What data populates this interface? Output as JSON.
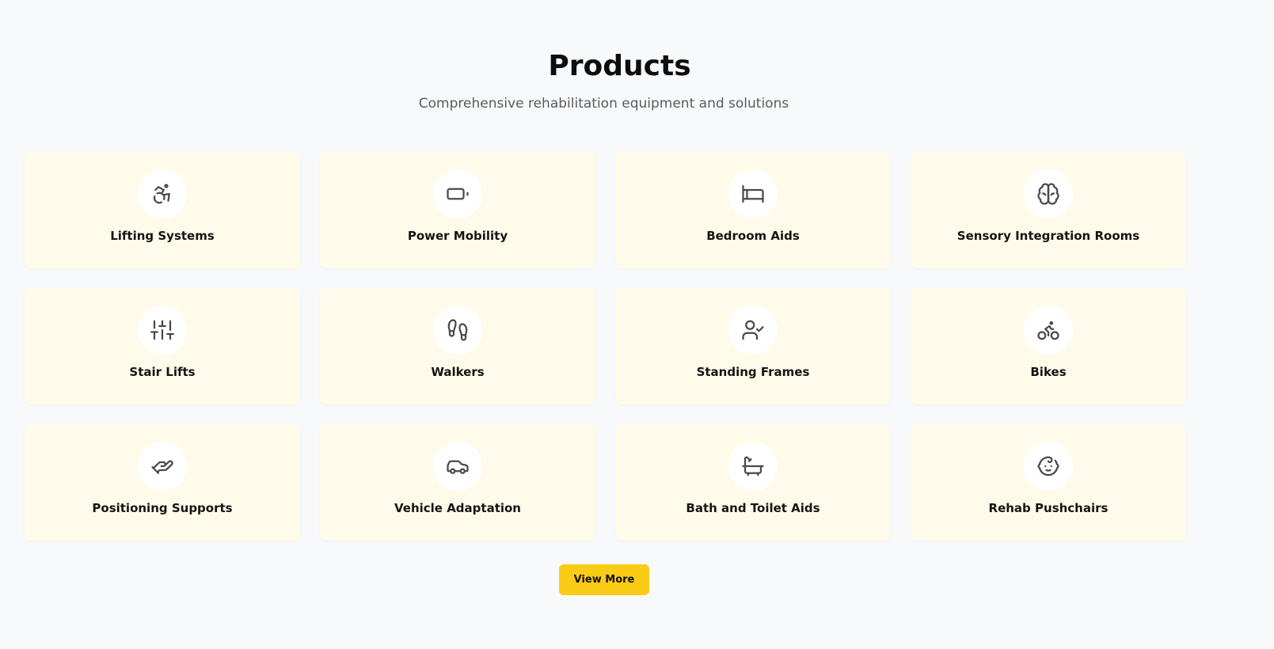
{
  "header": {
    "title": "Products",
    "subtitle": "Comprehensive rehabilitation equipment and solutions"
  },
  "products": [
    {
      "label": "Lifting Systems",
      "icon": "accessibility-icon"
    },
    {
      "label": "Power Mobility",
      "icon": "battery-icon"
    },
    {
      "label": "Bedroom Aids",
      "icon": "bed-icon"
    },
    {
      "label": "Sensory Integration Rooms",
      "icon": "brain-icon"
    },
    {
      "label": "Stair Lifts",
      "icon": "sliders-icon"
    },
    {
      "label": "Walkers",
      "icon": "footprints-icon"
    },
    {
      "label": "Standing Frames",
      "icon": "user-check-icon"
    },
    {
      "label": "Bikes",
      "icon": "bike-icon"
    },
    {
      "label": "Positioning Supports",
      "icon": "hand-heart-icon"
    },
    {
      "label": "Vehicle Adaptation",
      "icon": "car-icon"
    },
    {
      "label": "Bath and Toilet Aids",
      "icon": "bath-icon"
    },
    {
      "label": "Rehab Pushchairs",
      "icon": "baby-icon"
    }
  ],
  "actions": {
    "view_more_label": "View More"
  },
  "colors": {
    "card_background": "#fffbea",
    "button_background": "#facc15",
    "page_background": "#f8f9fb"
  }
}
